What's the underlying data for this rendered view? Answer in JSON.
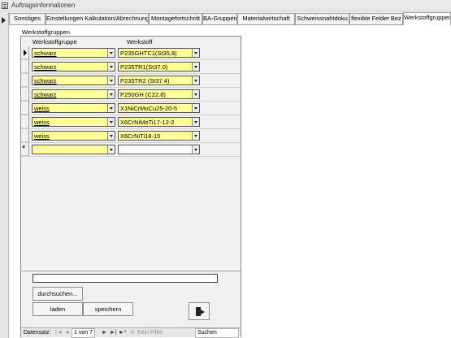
{
  "window": {
    "title": "Auftragsinformationen"
  },
  "tabs": [
    {
      "label": "Sonstiges",
      "active": false
    },
    {
      "label": "Einstellungen Kalkulation/Abrechnung",
      "active": false
    },
    {
      "label": "Montagefortschritt",
      "active": false
    },
    {
      "label": "BA-Gruppen",
      "active": false
    },
    {
      "label": "Materialwirtschaft",
      "active": false
    },
    {
      "label": "Schweissnahtdoku",
      "active": false
    },
    {
      "label": "flexible Felder Bez",
      "active": false
    },
    {
      "label": "Werkstoffgruppen",
      "active": true
    }
  ],
  "section": {
    "label": "Werkstoffgruppen"
  },
  "grid": {
    "columns": [
      "Werkstoffgruppe",
      "Werkstoff"
    ],
    "rows": [
      {
        "gruppe": "schwarz",
        "werkstoff": "P235GHTC1(St35.8)"
      },
      {
        "gruppe": "schwarz",
        "werkstoff": "P235TR1(St37.0)"
      },
      {
        "gruppe": "schwarz",
        "werkstoff": "P235TR2 (St37.4)"
      },
      {
        "gruppe": "schwarz",
        "werkstoff": "P250GH (C22.8)"
      },
      {
        "gruppe": "weiss",
        "werkstoff": "X1NiCrMoCu25-20-5"
      },
      {
        "gruppe": "weiss",
        "werkstoff": "X6CrNiMoTi17-12-2"
      },
      {
        "gruppe": "weiss",
        "werkstoff": "X6CrNiTi18-10"
      }
    ],
    "new_row_marker": "*",
    "colors": {
      "combo_yellow": "#ffff99"
    }
  },
  "buttons": {
    "search": "durchsuchen...",
    "load": "laden",
    "save": "speichern",
    "exit_icon": "exit-door-icon"
  },
  "navigation": {
    "label": "Datensatz:",
    "position": "1 von 7",
    "filter": "Kein Filter",
    "search": "Suchen"
  }
}
